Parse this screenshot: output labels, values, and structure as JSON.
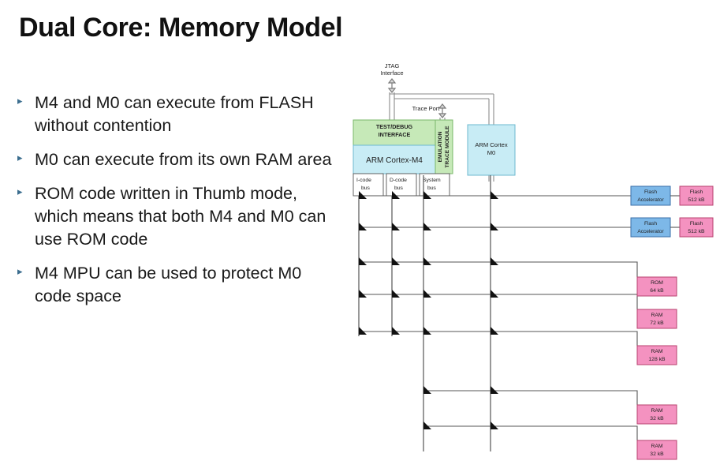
{
  "slide": {
    "title": "Dual Core: Memory Model",
    "bullet_marker": "▸"
  },
  "bullets": [
    {
      "text": "M4 and M0 can execute from FLASH without contention"
    },
    {
      "text": "M0 can execute from its own RAM area"
    },
    {
      "text": "ROM code written in Thumb mode, which means that both M4 and M0 can use ROM code"
    },
    {
      "text": "M4 MPU can be used to protect M0 code space"
    }
  ],
  "diagram": {
    "jtag": {
      "line1": "JTAG",
      "line2": "Interface"
    },
    "trace_port": "Trace Port",
    "test_debug": {
      "line1": "TEST/DEBUG",
      "line2": "INTERFACE"
    },
    "cortex_m4": "ARM Cortex-M4",
    "etm": {
      "line1": "EMULATION",
      "line2": "TRACE MODULE"
    },
    "cortex_m0": {
      "line1": "ARM Cortex",
      "line2": "M0"
    },
    "buses": [
      {
        "line1": "I-code",
        "line2": "bus"
      },
      {
        "line1": "D-code",
        "line2": "bus"
      },
      {
        "line1": "System",
        "line2": "bus"
      }
    ],
    "accelerators": [
      {
        "line1": "Flash",
        "line2": "Accelerator"
      },
      {
        "line1": "Flash",
        "line2": "Accelerator"
      }
    ],
    "memories": [
      {
        "line1": "Flash",
        "line2": "512 kB"
      },
      {
        "line1": "Flash",
        "line2": "512 kB"
      },
      {
        "line1": "ROM",
        "line2": "64 kB"
      },
      {
        "line1": "RAM",
        "line2": "72 kB"
      },
      {
        "line1": "RAM",
        "line2": "128 kB"
      },
      {
        "line1": "RAM",
        "line2": "32 kB"
      },
      {
        "line1": "RAM",
        "line2": "32 kB"
      }
    ],
    "colors": {
      "green_block": "#c6e9b8",
      "blue_block": "#c8ecf5",
      "accel_blue": "#7db8e8",
      "memory_pink": "#f492c0",
      "line": "#6f6f6f",
      "dark_line": "#222222"
    }
  }
}
